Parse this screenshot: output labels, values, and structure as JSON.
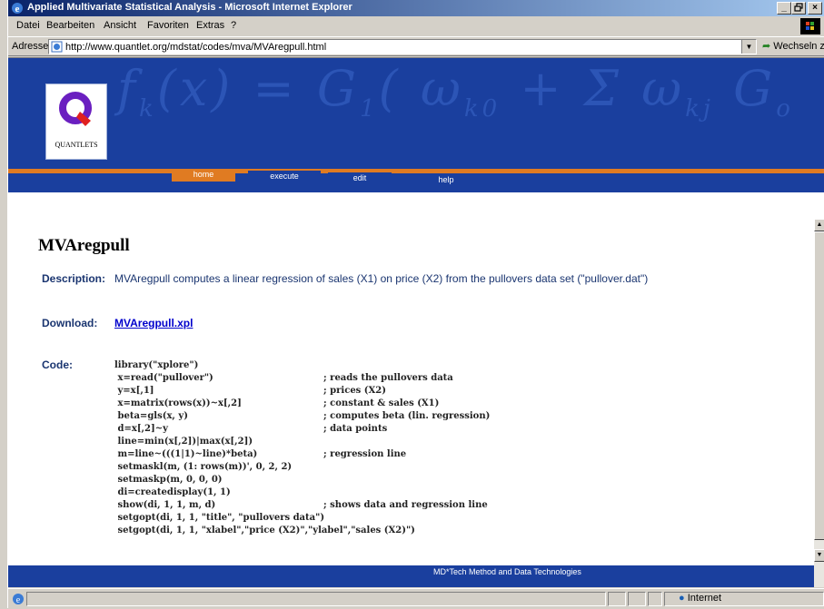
{
  "window": {
    "title": "Applied Multivariate Statistical Analysis - Microsoft Internet Explorer",
    "caption_buttons": [
      "_",
      "×"
    ]
  },
  "menubar": {
    "items": [
      "Datei",
      "Bearbeiten",
      "Ansicht",
      "Favoriten",
      "Extras",
      "?"
    ]
  },
  "addressbar": {
    "label": "Adresse",
    "url": "http://www.quantlet.org/mdstat/codes/mva/MVAregpull.html",
    "go_label": "Wechseln zu"
  },
  "banner": {
    "logo_text": "QUANTLETS",
    "nav_tabs": [
      "home",
      "execute",
      "edit",
      "help"
    ]
  },
  "page": {
    "title": "MVAregpull",
    "description_label": "Description:",
    "description_text": "MVAregpull computes a linear regression of sales (X1) on price (X2) from the pullovers data set (\"pullover.dat\")",
    "download_label": "Download:",
    "download_link": "MVAregpull.xpl",
    "code_label": "Code:",
    "code_lines": [
      {
        "code": "library(\"xplore\")",
        "comment": ""
      },
      {
        "code": " x=read(\"pullover\")",
        "comment": "; reads the pullovers data"
      },
      {
        "code": " y=x[,1]",
        "comment": "; prices (X2)"
      },
      {
        "code": " x=matrix(rows(x))~x[,2]",
        "comment": "; constant & sales (X1)"
      },
      {
        "code": " beta=gls(x, y)",
        "comment": "; computes beta (lin. regression)"
      },
      {
        "code": " d=x[,2]~y",
        "comment": "; data points"
      },
      {
        "code": " line=min(x[,2])|max(x[,2])",
        "comment": ""
      },
      {
        "code": " m=line~(((1|1)~line)*beta)",
        "comment": "; regression line"
      },
      {
        "code": " setmaskl(m, (1: rows(m))', 0, 2, 2)",
        "comment": ""
      },
      {
        "code": " setmaskp(m, 0, 0, 0)",
        "comment": ""
      },
      {
        "code": " di=createdisplay(1, 1)",
        "comment": ""
      },
      {
        "code": " show(di, 1, 1, m, d)",
        "comment": "; shows data and regression line"
      },
      {
        "code": " setgopt(di, 1, 1, \"title\", \"pullovers data\")",
        "comment": ""
      },
      {
        "code": " setgopt(di, 1, 1, \"xlabel\",\"price (X2)\",\"ylabel\",\"sales (X2)\")",
        "comment": ""
      }
    ],
    "footer_text": "MD*Tech  Method and Data Technologies"
  },
  "statusbar": {
    "zone": "Internet"
  },
  "colors": {
    "banner_blue": "#1a3f9e",
    "accent_orange": "#e07b22",
    "text_navy": "#1a3570",
    "link_blue": "#0000cc"
  }
}
